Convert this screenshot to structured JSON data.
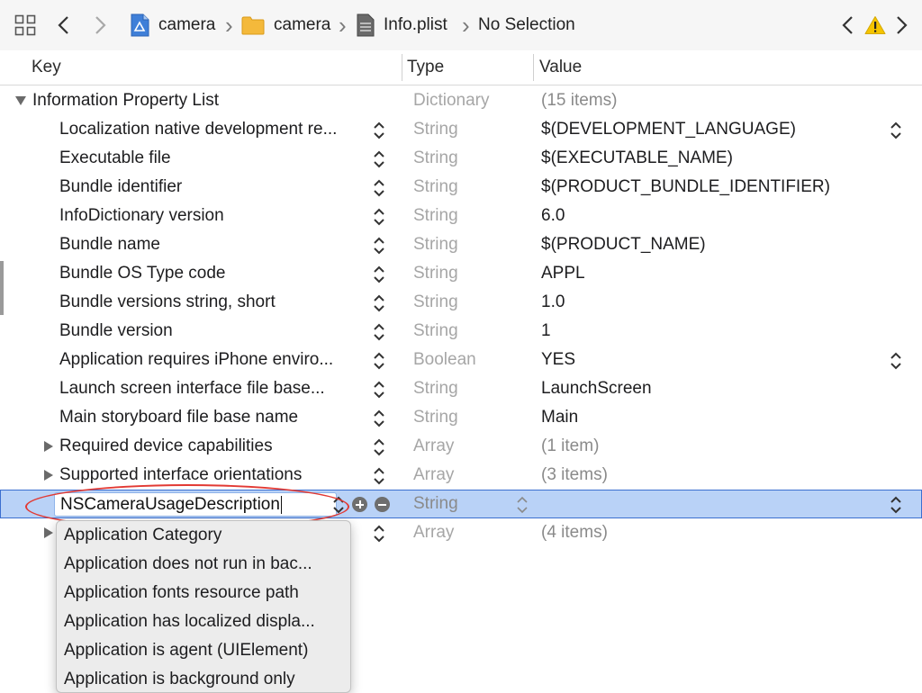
{
  "breadcrumb": {
    "items": [
      {
        "label": "camera",
        "icon": "project-file-icon"
      },
      {
        "label": "camera",
        "icon": "folder-icon"
      },
      {
        "label": "Info.plist",
        "icon": "plist-file-icon"
      },
      {
        "label": "No Selection",
        "icon": ""
      }
    ]
  },
  "columns": {
    "key": "Key",
    "type": "Type",
    "value": "Value"
  },
  "rows": [
    {
      "key": "Information Property List",
      "type": "Dictionary",
      "value": "(15 items)"
    },
    {
      "key": "Localization native development re...",
      "type": "String",
      "value": "$(DEVELOPMENT_LANGUAGE)"
    },
    {
      "key": "Executable file",
      "type": "String",
      "value": "$(EXECUTABLE_NAME)"
    },
    {
      "key": "Bundle identifier",
      "type": "String",
      "value": "$(PRODUCT_BUNDLE_IDENTIFIER)"
    },
    {
      "key": "InfoDictionary version",
      "type": "String",
      "value": "6.0"
    },
    {
      "key": "Bundle name",
      "type": "String",
      "value": "$(PRODUCT_NAME)"
    },
    {
      "key": "Bundle OS Type code",
      "type": "String",
      "value": "APPL"
    },
    {
      "key": "Bundle versions string, short",
      "type": "String",
      "value": "1.0"
    },
    {
      "key": "Bundle version",
      "type": "String",
      "value": "1"
    },
    {
      "key": "Application requires iPhone enviro...",
      "type": "Boolean",
      "value": "YES"
    },
    {
      "key": "Launch screen interface file base...",
      "type": "String",
      "value": "LaunchScreen"
    },
    {
      "key": "Main storyboard file base name",
      "type": "String",
      "value": "Main"
    },
    {
      "key": "Required device capabilities",
      "type": "Array",
      "value": "(1 item)"
    },
    {
      "key": "Supported interface orientations",
      "type": "Array",
      "value": "(3 items)"
    },
    {
      "key": "NSCameraUsageDescription",
      "type": "String",
      "value": ""
    },
    {
      "key": "",
      "type": "Array",
      "value": "(4 items)"
    }
  ],
  "autocomplete": {
    "items": [
      "Application Category",
      "Application does not run in bac...",
      "Application fonts resource path",
      "Application has localized displa...",
      "Application is agent (UIElement)",
      "Application is background only"
    ]
  },
  "colors": {
    "selection": "#b9d2f7",
    "selection_border": "#3b6fd0",
    "highlight_ellipse": "#e23a34",
    "warning": "#f5c400"
  }
}
